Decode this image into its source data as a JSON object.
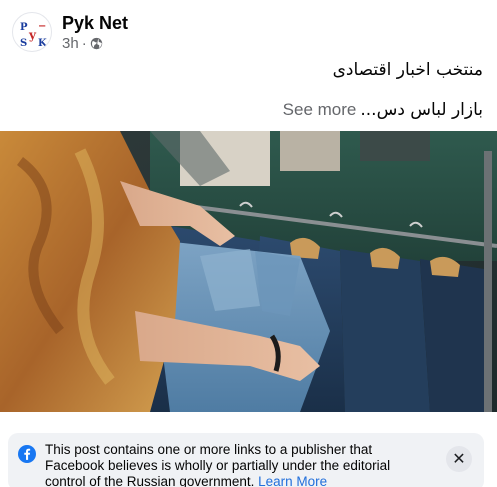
{
  "post": {
    "page_name": "Pyk Net",
    "time": "3h",
    "separator": "·",
    "avatar_letters": {
      "p": "P",
      "y": "y",
      "s": "S",
      "k": "K",
      "dash": "−"
    },
    "caption_line1": "منتخب اخبار اقتصادی",
    "caption_line2": "بازار لباس دس...",
    "see_more": "See more"
  },
  "notice": {
    "text": "This post contains one or more links to a publisher that Facebook believes is wholly or partially under the editorial control of the Russian government.",
    "learn_more": "Learn More",
    "close_glyph": "✕"
  },
  "colors": {
    "link": "#216fdb",
    "muted": "#65676b",
    "notice_bg": "#f0f2f5"
  }
}
